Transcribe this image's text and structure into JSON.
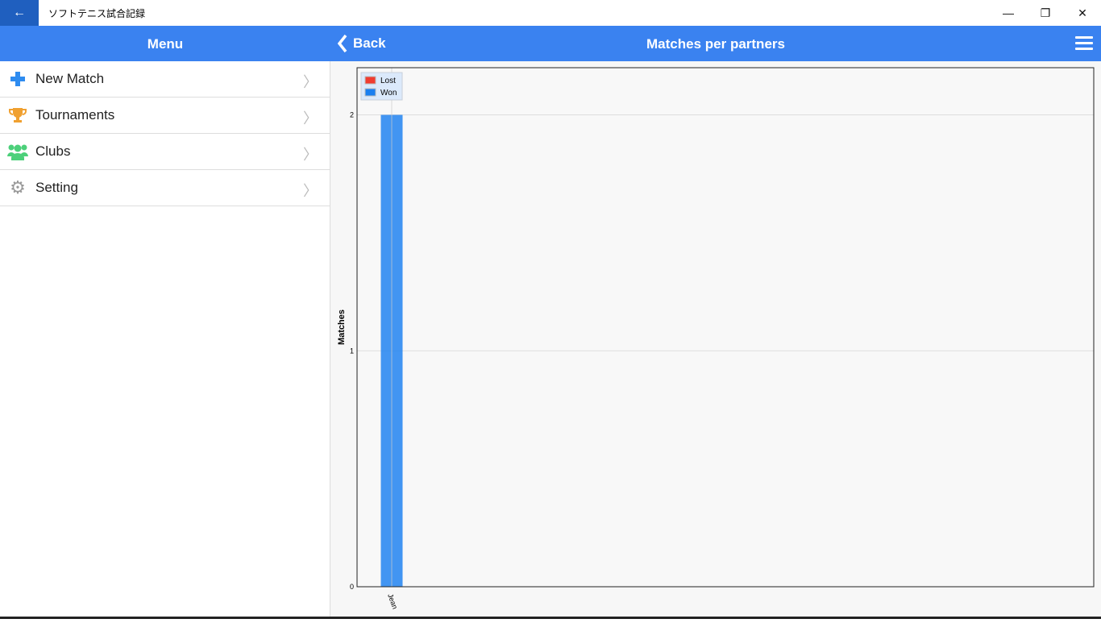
{
  "window": {
    "title": "ソフトテニス試合記録",
    "back_icon": "arrow-left-icon"
  },
  "header": {
    "menu_title": "Menu",
    "back_label": "Back",
    "page_title": "Matches per partners"
  },
  "sidebar": {
    "items": [
      {
        "label": "New Match",
        "icon": "plus-icon",
        "color": "#2e8cf0"
      },
      {
        "label": "Tournaments",
        "icon": "trophy-icon",
        "color": "#f0a030"
      },
      {
        "label": "Clubs",
        "icon": "users-icon",
        "color": "#4cd07a"
      },
      {
        "label": "Setting",
        "icon": "gear-icon",
        "color": "#999999"
      }
    ]
  },
  "chart_data": {
    "type": "bar",
    "stacked": true,
    "categories": [
      "Jean"
    ],
    "series": [
      {
        "name": "Lost",
        "values": [
          0
        ],
        "color": "#f03c30"
      },
      {
        "name": "Won",
        "values": [
          2
        ],
        "color": "#1a7ff0"
      }
    ],
    "ylabel": "Matches",
    "ylim": [
      0,
      2.2
    ],
    "yticks": [
      "0",
      "1",
      "2"
    ],
    "grid": true,
    "legend": "top-left"
  }
}
